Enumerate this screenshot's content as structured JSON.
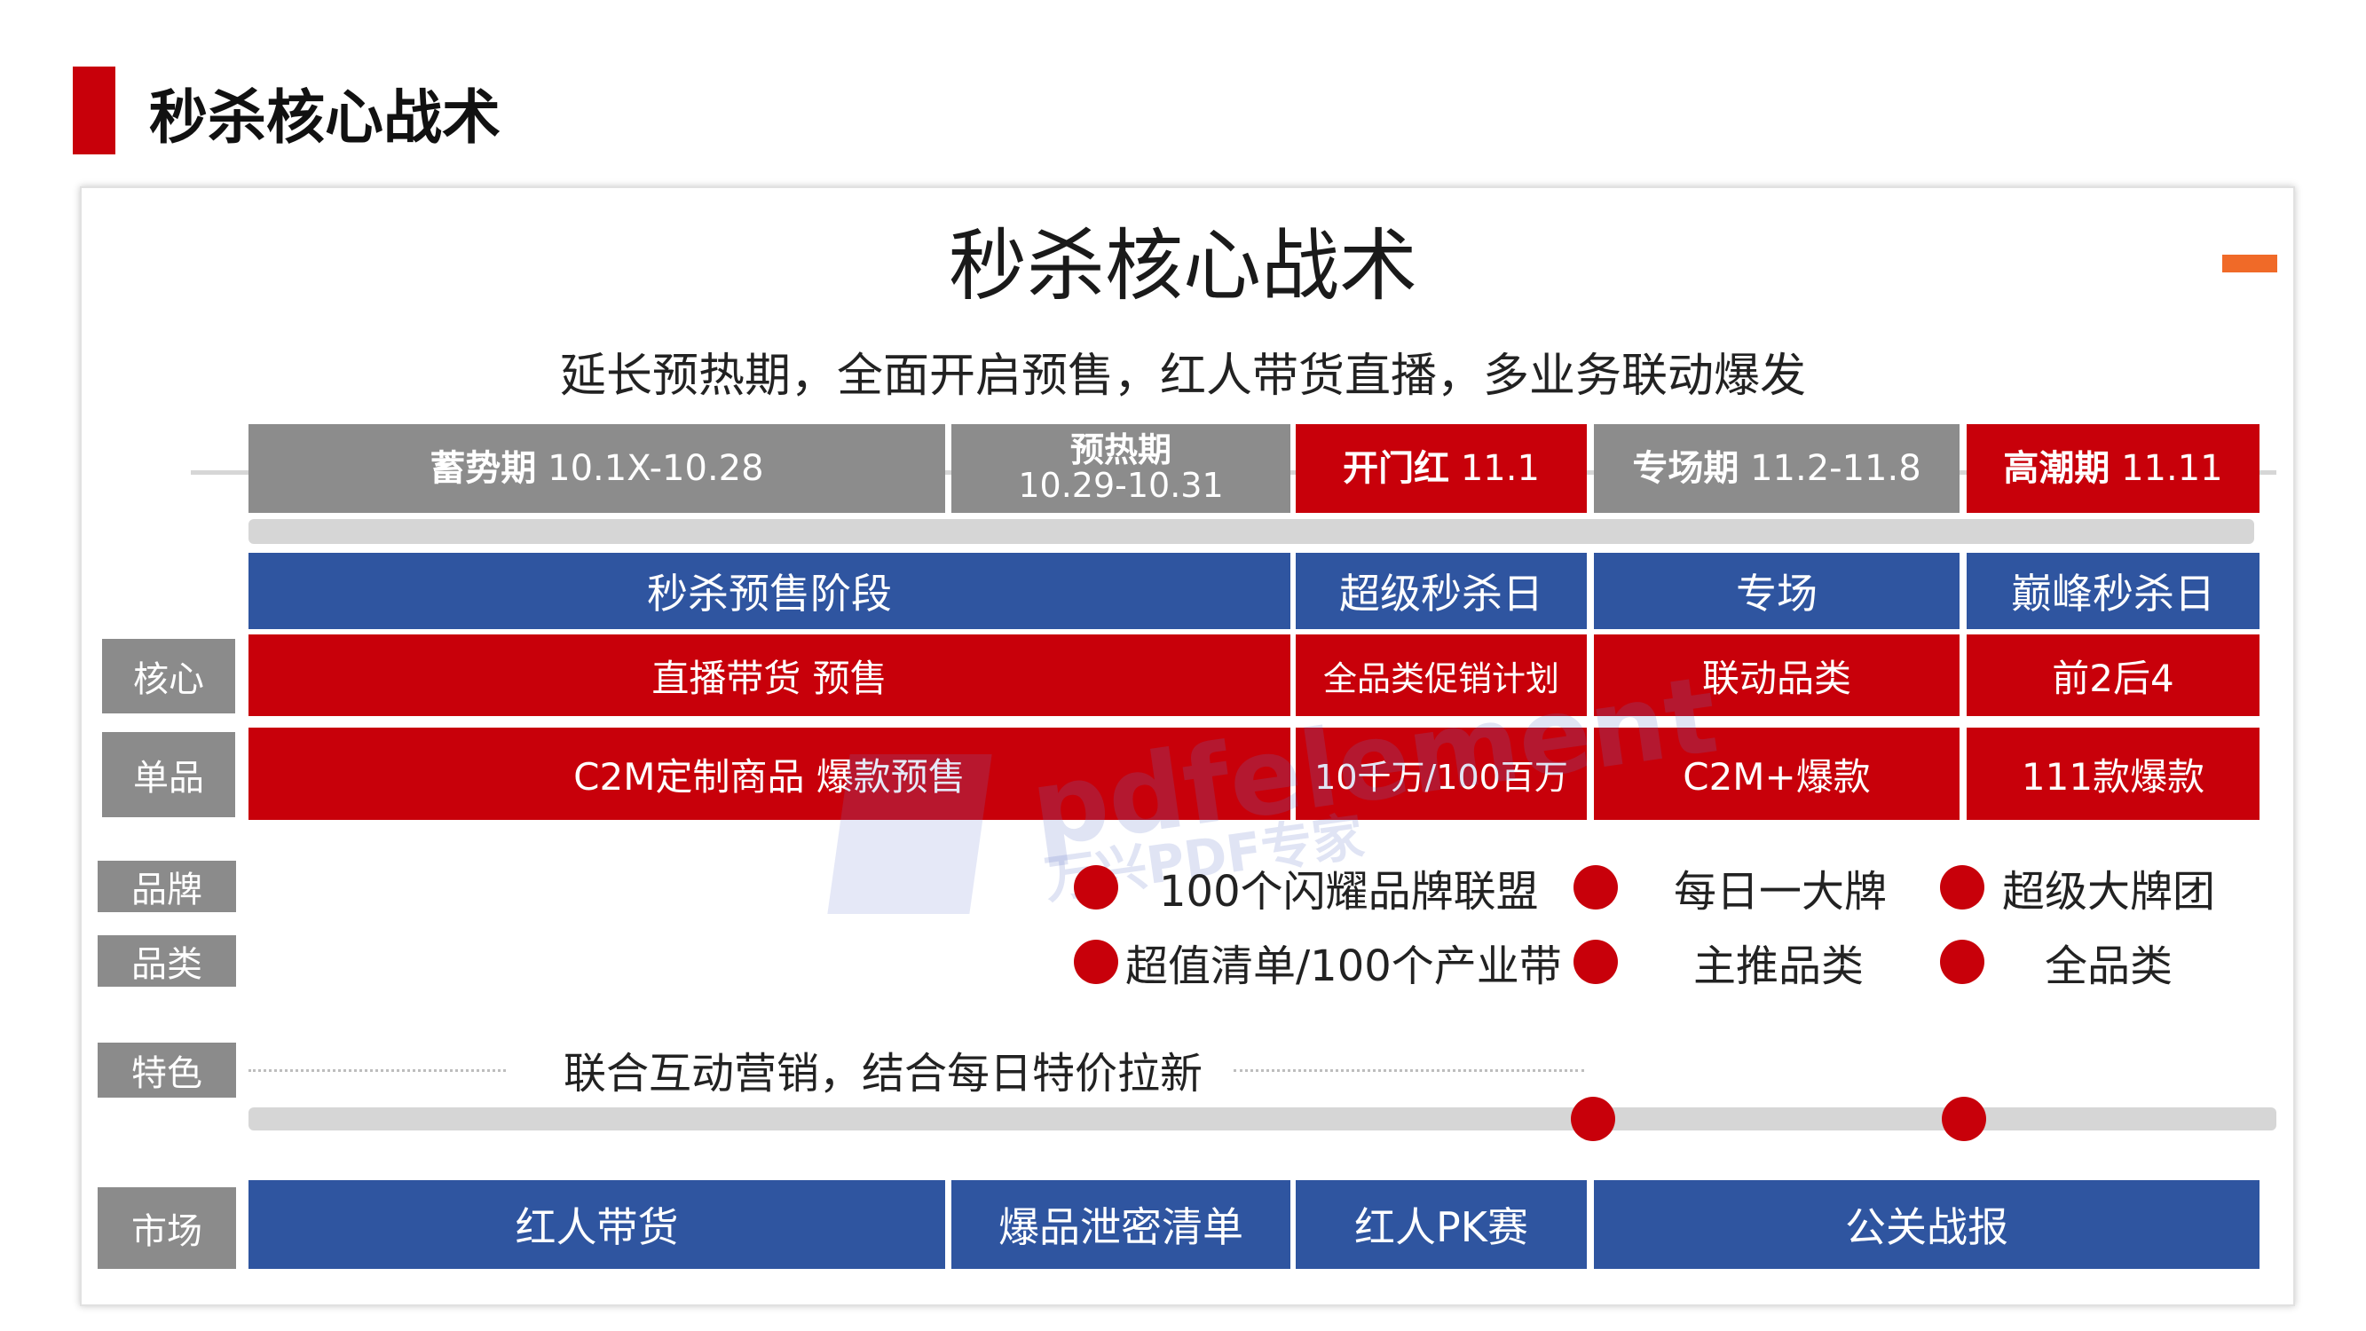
{
  "heading": "秒杀核心战术",
  "card": {
    "title": "秒杀核心战术",
    "subtitle": "延长预热期，全面开启预售，红人带货直播，多业务联动爆发"
  },
  "phases": [
    {
      "name": "蓄势期",
      "dates": "10.1X-10.28",
      "color": "#8c8c8c"
    },
    {
      "name": "预热期",
      "dates": "10.29-10.31",
      "color": "#8c8c8c"
    },
    {
      "name": "开门红",
      "dates": "11.1",
      "color": "#c8000a"
    },
    {
      "name": "专场期",
      "dates": "11.2-11.8",
      "color": "#8c8c8c"
    },
    {
      "name": "高潮期",
      "dates": "11.11",
      "color": "#c8000a"
    }
  ],
  "stages": [
    "秒杀预售阶段",
    "超级秒杀日",
    "专场",
    "巅峰秒杀日"
  ],
  "rows": {
    "core": {
      "label": "核心",
      "cells": [
        "直播带货 预售",
        "全品类促销计划",
        "联动品类",
        "前2后4"
      ]
    },
    "product": {
      "label": "单品",
      "cells": [
        "C2M定制商品 爆款预售",
        "10千万/100百万",
        "C2M+爆款",
        "111款爆款"
      ]
    },
    "brand": {
      "label": "品牌",
      "items": [
        "100个闪耀品牌联盟",
        "每日一大牌",
        "超级大牌团"
      ]
    },
    "category": {
      "label": "品类",
      "items": [
        "超值清单/100个产业带",
        "主推品类",
        "全品类"
      ]
    },
    "feature": {
      "label": "特色",
      "text": "联合互动营销，结合每日特价拉新"
    },
    "market": {
      "label": "市场",
      "cells": [
        "红人带货",
        "爆品泄密清单",
        "红人PK赛",
        "公关战报"
      ]
    }
  },
  "watermark": {
    "brand": "pdfelement",
    "product": "万兴PDF专家"
  },
  "colors": {
    "red": "#c8000a",
    "blue": "#2f55a0",
    "gray": "#8c8c8c"
  }
}
